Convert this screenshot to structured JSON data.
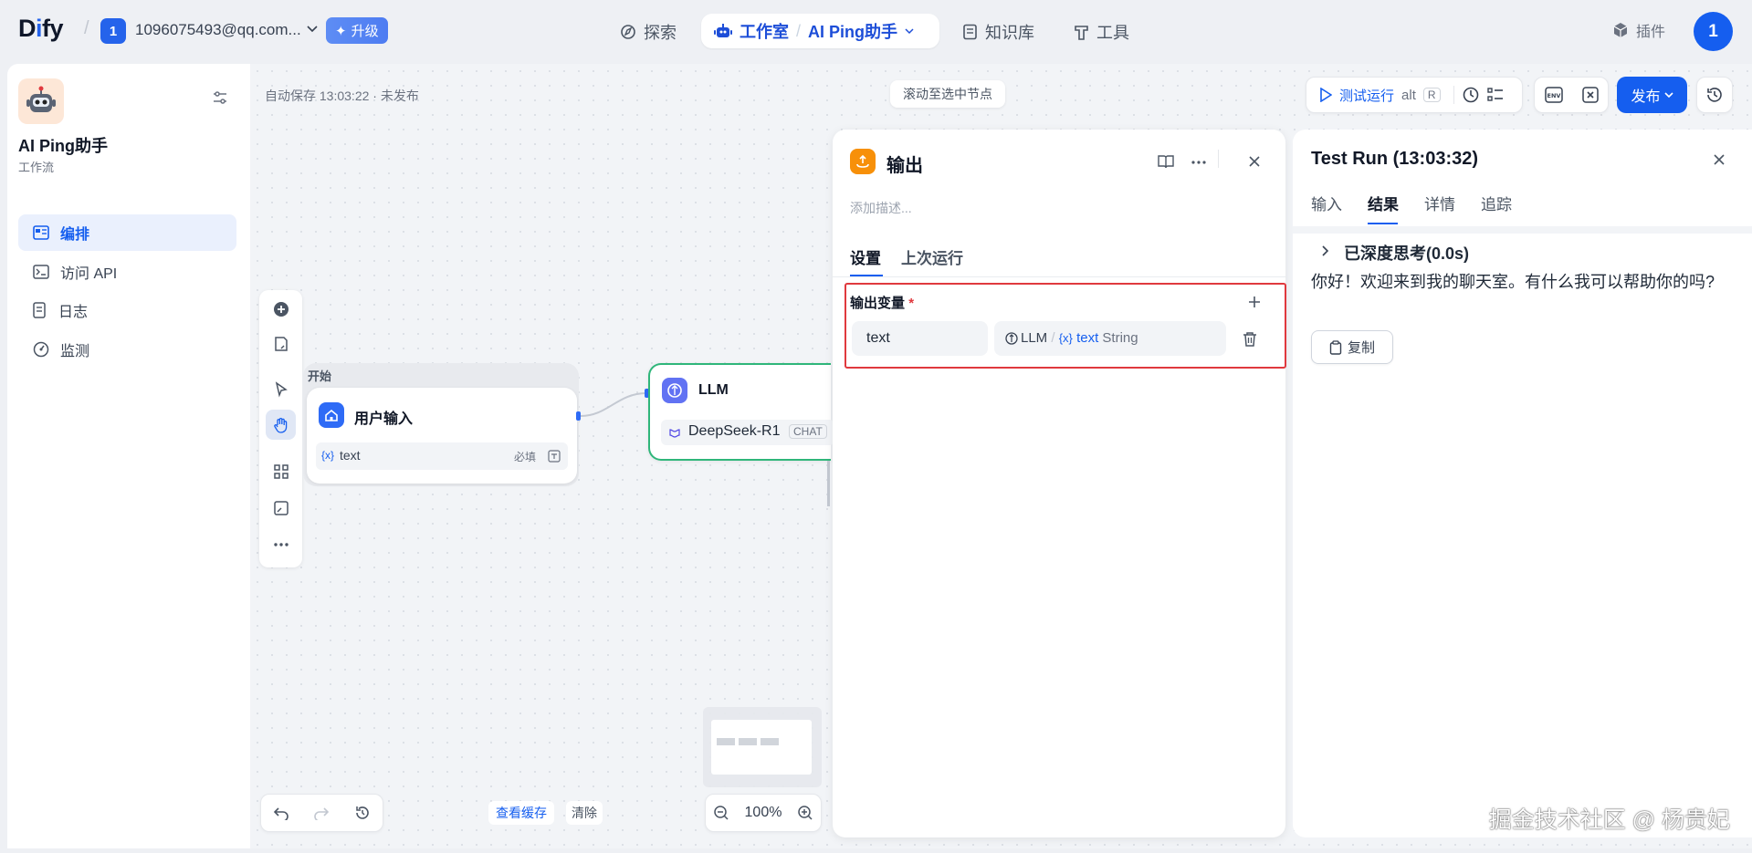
{
  "brand": {
    "logo_d": "D",
    "logo_i": "i",
    "logo_fy": "fy"
  },
  "workspace": {
    "avatar": "1",
    "name": "1096075493@qq.com...",
    "upgrade": "升级"
  },
  "nav": {
    "explore": "探索",
    "studio": "工作室",
    "app": "AI Ping助手",
    "knowledge": "知识库",
    "tools": "工具",
    "plugins": "插件",
    "user_avatar": "1"
  },
  "sidebar": {
    "app_title": "AI Ping助手",
    "app_type": "工作流",
    "items": [
      {
        "label": "编排",
        "icon": "layout-icon"
      },
      {
        "label": "访问 API",
        "icon": "terminal-icon"
      },
      {
        "label": "日志",
        "icon": "file-list-icon"
      },
      {
        "label": "监测",
        "icon": "gauge-icon"
      }
    ]
  },
  "canvas": {
    "autosave": "自动保存 13:03:22 · 未发布",
    "scroll_to_node": "滚动至选中节点",
    "test_run": "测试运行",
    "shortcut_alt": "alt",
    "shortcut_r": "R",
    "env_label": "ENV",
    "publish": "发布",
    "view_cache": "查看缓存",
    "clear": "清除",
    "zoom": "100%"
  },
  "nodes": {
    "start_label": "开始",
    "start_title": "用户输入",
    "start_var_prefix": "{x}",
    "start_var": "text",
    "start_required": "必填",
    "llm_title": "LLM",
    "llm_model": "DeepSeek-R1",
    "llm_mode": "CHAT"
  },
  "output_panel": {
    "title": "输出",
    "desc_placeholder": "添加描述...",
    "tab_settings": "设置",
    "tab_last_run": "上次运行",
    "section_title": "输出变量",
    "required_mark": "*",
    "var_name": "text",
    "ref_node": "LLM",
    "ref_sep": "/",
    "ref_prefix": "{x}",
    "ref_var": "text",
    "ref_type": "String"
  },
  "run_panel": {
    "title": "Test Run (13:03:32)",
    "tabs": [
      "输入",
      "结果",
      "详情",
      "追踪"
    ],
    "active_tab": "结果",
    "thinking": "已深度思考(0.0s)",
    "result": "你好！欢迎来到我的聊天室。有什么我可以帮助你的吗?",
    "copy": "复制"
  },
  "watermark": "掘金技术社区 @ 杨贵妃",
  "colors": {
    "primary": "#155eef",
    "highlight_border": "#e0393e",
    "llm_border": "#2fb67a",
    "output_icon": "#f79009"
  }
}
